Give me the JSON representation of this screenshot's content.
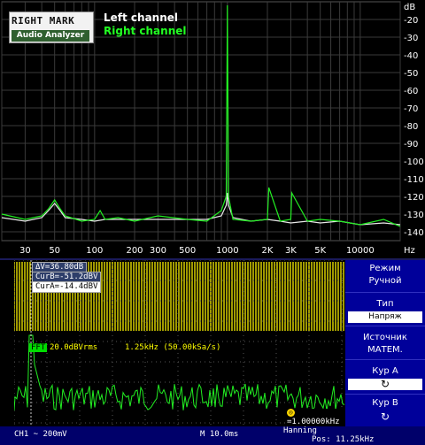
{
  "rmaa": {
    "logo_top": "RIGHT MARK",
    "logo_bottom": "Audio Analyzer",
    "legend_left": "Left channel",
    "legend_right": "Right channel",
    "y_unit": "dB",
    "x_unit": "Hz",
    "colors": {
      "left": "#e8e8e8",
      "right": "#22ee22",
      "grid": "#3a3a3a",
      "axis_text": "#ffffff"
    }
  },
  "chart_data": {
    "type": "line",
    "xlabel": "Hz",
    "ylabel": "dB",
    "xscale": "log",
    "xlim": [
      20,
      20000
    ],
    "ylim": [
      -145,
      -10
    ],
    "x_ticks": [
      "30",
      "50",
      "100",
      "200",
      "300",
      "500",
      "1000",
      "2K",
      "3K",
      "5K",
      "10000"
    ],
    "x_tick_values": [
      30,
      50,
      100,
      200,
      300,
      500,
      1000,
      2000,
      3000,
      5000,
      10000
    ],
    "y_ticks": [
      "-20",
      "-30",
      "-40",
      "-50",
      "-60",
      "-70",
      "-80",
      "-90",
      "-100",
      "-110",
      "-120",
      "-130",
      "-140"
    ],
    "y_tick_values": [
      -20,
      -30,
      -40,
      -50,
      -60,
      -70,
      -80,
      -90,
      -100,
      -110,
      -120,
      -130,
      -140
    ],
    "grid": true,
    "series": [
      {
        "name": "Left channel",
        "x": [
          20,
          30,
          40,
          45,
          50,
          55,
          60,
          80,
          100,
          120,
          150,
          200,
          300,
          500,
          700,
          900,
          980,
          1000,
          1020,
          1100,
          1500,
          2000,
          2500,
          3000,
          4000,
          5000,
          7000,
          10000,
          15000,
          20000
        ],
        "y": [
          -132,
          -134,
          -132,
          -128,
          -124,
          -128,
          -132,
          -133,
          -134,
          -133,
          -133,
          -133,
          -133,
          -133,
          -133,
          -131,
          -125,
          -118,
          -125,
          -132,
          -134,
          -133,
          -134,
          -135,
          -134,
          -135,
          -134,
          -136,
          -135,
          -136
        ]
      },
      {
        "name": "Right channel",
        "x": [
          20,
          30,
          40,
          45,
          50,
          55,
          60,
          80,
          100,
          110,
          120,
          150,
          200,
          300,
          500,
          700,
          900,
          980,
          1000,
          1020,
          1100,
          1500,
          2000,
          2050,
          2500,
          3000,
          3050,
          4000,
          5000,
          7000,
          10000,
          15000,
          20000
        ],
        "y": [
          -130,
          -133,
          -131,
          -127,
          -122,
          -127,
          -131,
          -134,
          -133,
          -128,
          -133,
          -132,
          -134,
          -131,
          -133,
          -134,
          -128,
          -120,
          -12,
          -120,
          -133,
          -134,
          -133,
          -115,
          -134,
          -133,
          -118,
          -134,
          -133,
          -134,
          -136,
          -133,
          -137
        ]
      }
    ]
  },
  "scope": {
    "meas_dv": "ΔV=36.80dB",
    "meas_curb": "CurB=-51.2dBV",
    "meas_cura": "CurA=-14.4dBV",
    "fft_tag": "FFT",
    "fft_scale": "20.0dBVrms",
    "fft_span": "1.25kHz (50.00kSa/s)",
    "freq_readout": "=1.00000kHz",
    "menu": {
      "mode_label": "Режим",
      "mode_value": "Ручной",
      "type_label": "Тип",
      "type_value": "Напряж",
      "source_label": "Источник",
      "source_value": "МАТЕМ.",
      "cur_a_label": "Кур A",
      "cur_b_label": "Кур B"
    },
    "status": {
      "ch1": "CH1 ~ 200mV",
      "timebase": "M 10.0ms",
      "window": "Hanning",
      "pos": "Pos: 11.25kHz"
    },
    "colors": {
      "trace": "#22ee22",
      "yellow_band": "#c8c000",
      "menu_bg": "#00009a"
    }
  }
}
